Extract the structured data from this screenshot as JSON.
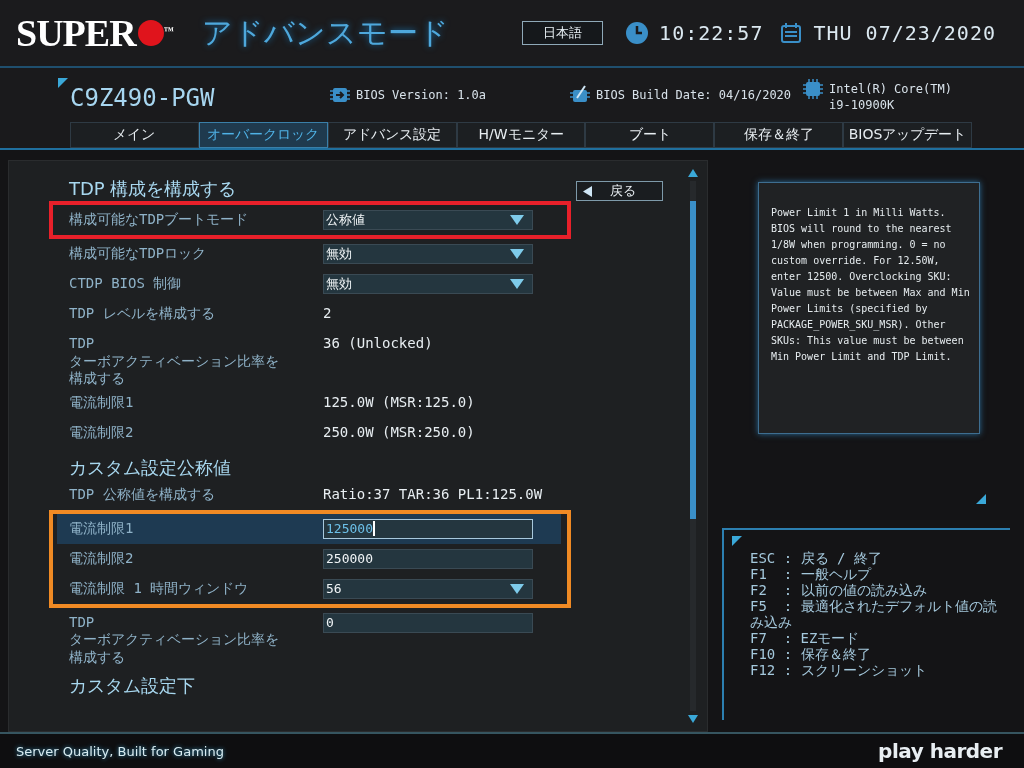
{
  "header": {
    "logo_text": "SUPER",
    "logo_mark": "™",
    "mode_title": "アドバンスモード",
    "language_button": "日本語",
    "time": "10:22:57",
    "date": "THU 07/23/2020"
  },
  "info": {
    "model": "C9Z490-PGW",
    "bios_version": "BIOS Version: 1.0a",
    "build_date": "BIOS Build Date: 04/16/2020",
    "cpu": "Intel(R) Core(TM)\ni9-10900K"
  },
  "tabs": [
    {
      "label": "メイン",
      "selected": false
    },
    {
      "label": "オーバークロック",
      "selected": true
    },
    {
      "label": "アドバンス設定",
      "selected": false
    },
    {
      "label": "H/Wモニター",
      "selected": false
    },
    {
      "label": "ブート",
      "selected": false
    },
    {
      "label": "保存＆終了",
      "selected": false
    },
    {
      "label": "BIOSアップデート",
      "selected": false
    }
  ],
  "back_button": "戻る",
  "blocks": [
    {
      "kind": "heading",
      "text": "TDP 構成を構成する"
    },
    {
      "kind": "group",
      "color": "#e8202a",
      "rows": [
        {
          "kind": "dropdown",
          "label": "構成可能なTDPブートモード",
          "value": "公称値",
          "selected": false
        }
      ]
    },
    {
      "kind": "dropdown",
      "label": "構成可能なTDPロック",
      "value": "無効",
      "selected": false
    },
    {
      "kind": "dropdown",
      "label": "CTDP BIOS 制御",
      "value": "無効",
      "selected": false
    },
    {
      "kind": "text",
      "label": "TDP レベルを構成する",
      "value": "2",
      "selected": false
    },
    {
      "kind": "text",
      "label_lines": [
        "TDP",
        "ターボアクティベーション比率を",
        "構成する"
      ],
      "value": "36 (Unlocked)",
      "selected": false
    },
    {
      "kind": "text",
      "label": "電流制限1",
      "value": "125.0W (MSR:125.0)",
      "selected": false
    },
    {
      "kind": "text",
      "label": "電流制限2",
      "value": "250.0W (MSR:250.0)",
      "selected": false
    },
    {
      "kind": "heading",
      "text": "カスタム設定公称値"
    },
    {
      "kind": "text",
      "label": "TDP 公称値を構成する",
      "value": "Ratio:37 TAR:36 PL1:125.0W",
      "selected": false
    },
    {
      "kind": "group",
      "color": "#f08a24",
      "rows": [
        {
          "kind": "input",
          "label": "電流制限1",
          "value": "125000",
          "selected": true
        },
        {
          "kind": "input",
          "label": "電流制限2",
          "value": "250000",
          "selected": false
        },
        {
          "kind": "dropdown",
          "label": "電流制限 1 時間ウィンドウ",
          "value": "56",
          "selected": false
        }
      ]
    },
    {
      "kind": "input",
      "label_lines": [
        "TDP",
        "ターボアクティベーション比率を",
        "構成する"
      ],
      "value": "0",
      "selected": false
    },
    {
      "kind": "heading",
      "text": "カスタム設定下"
    }
  ],
  "help_text": "Power Limit 1 in Milli Watts. BIOS will round to the nearest 1/8W when programming. 0 = no custom override. For 12.50W, enter 12500. Overclocking SKU: Value must be between Max and Min Power Limits (specified by PACKAGE_POWER_SKU_MSR). Other SKUs: This value must be between Min Power Limit and TDP Limit.",
  "keys": [
    "ESC : 戻る / 終了",
    "F1  : 一般ヘルプ",
    "F2  : 以前の値の読み込み",
    "F5  : 最適化されたデフォルト値の読み込み",
    "F7  : EZモード",
    "F10 : 保存＆終了",
    "F12 : スクリーンショット"
  ],
  "footer": {
    "slogan": "Server Quality, Built for Gaming",
    "brand": "play harder"
  }
}
